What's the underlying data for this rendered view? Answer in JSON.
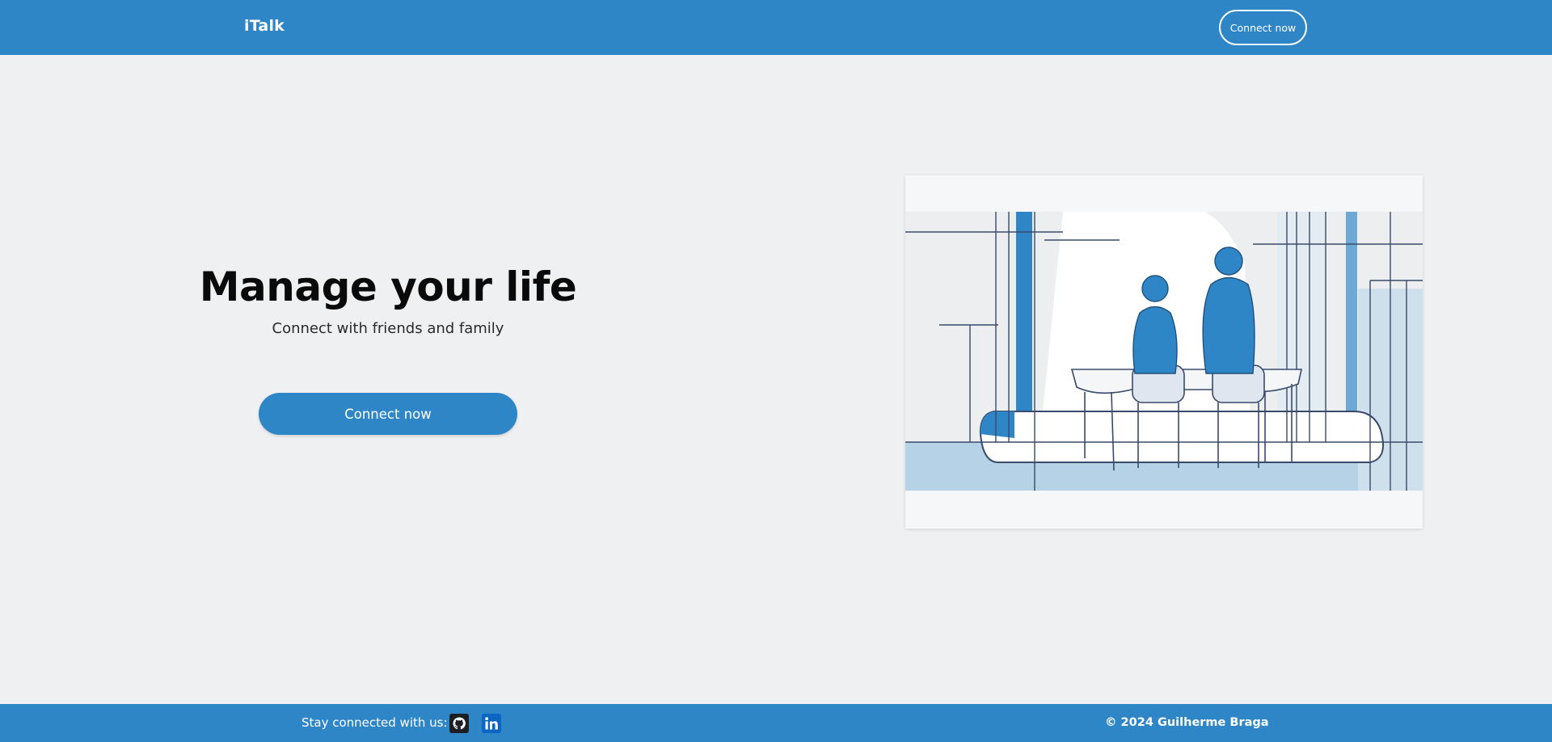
{
  "header": {
    "brand": "iTalk",
    "cta_label": "Connect now"
  },
  "hero": {
    "title": "Manage your life",
    "subtitle": "Connect with friends and family",
    "cta_label": "Connect now"
  },
  "footer": {
    "stay_connected": "Stay connected with us:",
    "social": [
      {
        "icon": "github-icon"
      },
      {
        "icon": "linkedin-icon"
      }
    ],
    "copyright": "© 2024 Guilherme Braga"
  },
  "colors": {
    "brand_blue": "#2f86c6",
    "background": "#eff0f1",
    "text_dark": "#0a0a0a",
    "white": "#ffffff"
  }
}
